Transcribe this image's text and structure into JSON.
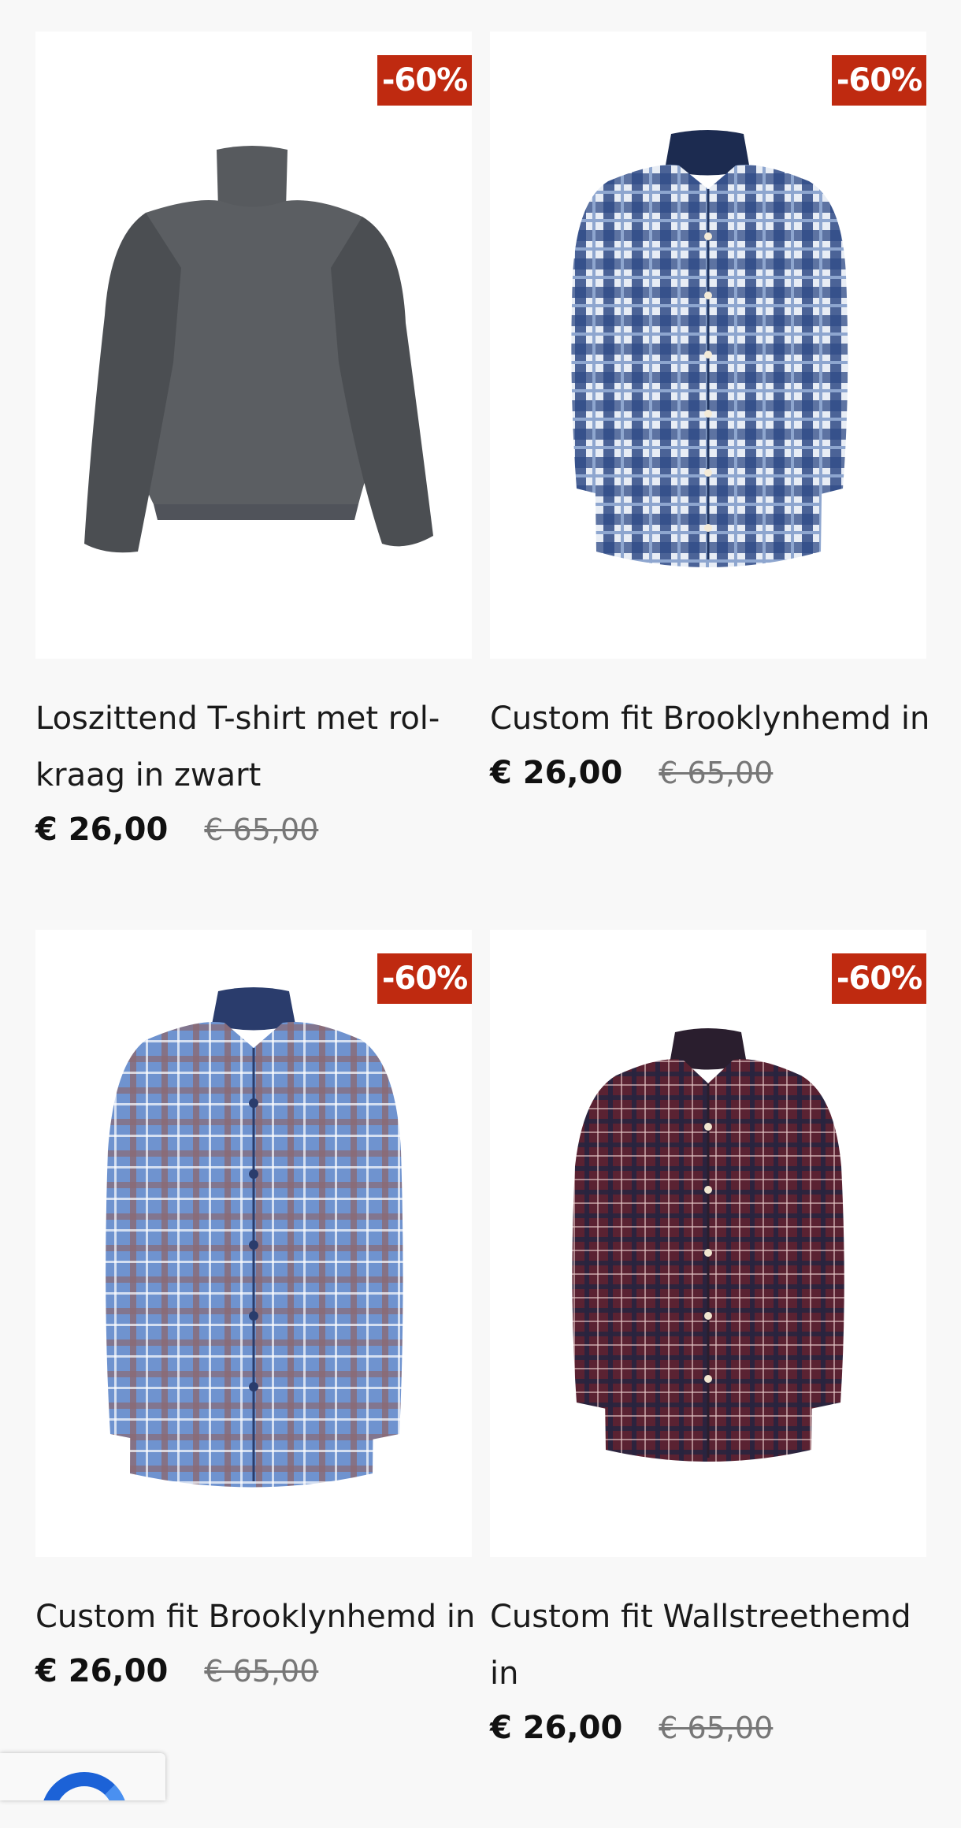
{
  "colors": {
    "badge_bg": "#bf2a10",
    "badge_text": "#ffffff",
    "price_old": "#777777",
    "background": "#f8f8f8"
  },
  "products": [
    {
      "badge": "-60%",
      "title": "Loszittend T-shirt met rol-kraag in zwart",
      "price_now": "€ 26,00",
      "price_old": "€ 65,00",
      "image_icon": "grey-turtleneck-top-image"
    },
    {
      "badge": "-60%",
      "title": "Custom fit Brooklynhemd in",
      "price_now": "€ 26,00",
      "price_old": "€ 65,00",
      "image_icon": "blue-white-plaid-shirt-image"
    },
    {
      "badge": "-60%",
      "title": "Custom fit Brooklynhemd in",
      "price_now": "€ 26,00",
      "price_old": "€ 65,00",
      "image_icon": "light-blue-plaid-shirt-image"
    },
    {
      "badge": "-60%",
      "title": "Custom fit Wallstreethemd in",
      "price_now": "€ 26,00",
      "price_old": "€ 65,00",
      "image_icon": "burgundy-check-shirt-image"
    }
  ],
  "recaptcha": {
    "icon": "recaptcha-logo-icon"
  }
}
